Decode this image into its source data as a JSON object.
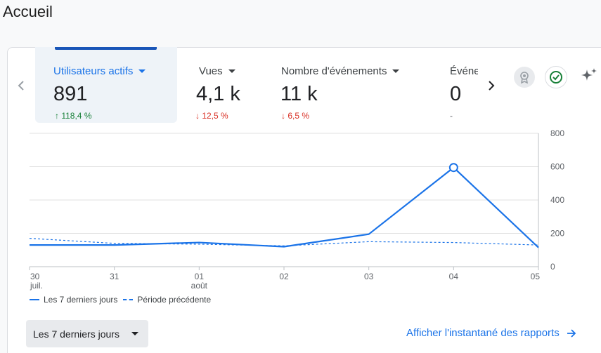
{
  "page": {
    "title": "Accueil"
  },
  "metrics": [
    {
      "label": "Utilisateurs actifs",
      "value": "891",
      "delta": "118,4 %",
      "trend": "up",
      "active": true
    },
    {
      "label": "Vues",
      "value": "4,1 k",
      "delta": "12,5 %",
      "trend": "down",
      "active": false
    },
    {
      "label": "Nombre d'événements",
      "value": "11 k",
      "delta": "6,5 %",
      "trend": "down",
      "active": false
    },
    {
      "label": "Événe",
      "value": "0",
      "delta": "-",
      "trend": "neutral",
      "active": false
    }
  ],
  "icons": {
    "prev": "chevron-left-icon",
    "next": "chevron-right-icon",
    "award": "award-icon",
    "check": "check-circle-icon",
    "sparkle": "sparkle-icon"
  },
  "colors": {
    "accent": "#1a73e8",
    "up": "#188038",
    "down": "#d93025"
  },
  "chart_data": {
    "type": "line",
    "categories": [
      "30 juil.",
      "31",
      "01 août",
      "02",
      "03",
      "04",
      "05"
    ],
    "x_tick_labels": [
      [
        "30",
        "juil."
      ],
      [
        "31"
      ],
      [
        "01",
        "août"
      ],
      [
        "02"
      ],
      [
        "03"
      ],
      [
        "04"
      ],
      [
        "05"
      ]
    ],
    "y_ticks": [
      "800",
      "600",
      "400",
      "200",
      "0"
    ],
    "ylim": [
      0,
      800
    ],
    "grid": true,
    "series": [
      {
        "name": "Les 7 derniers jours",
        "values": [
          130,
          130,
          145,
          120,
          195,
          595,
          115
        ],
        "style": "solid",
        "color": "#1a73e8"
      },
      {
        "name": "Période précédente",
        "values": [
          170,
          140,
          135,
          125,
          150,
          145,
          130
        ],
        "style": "dashed",
        "color": "#1a73e8"
      }
    ],
    "highlight_point_index": 5,
    "legend_position": "bottom-left"
  },
  "range": {
    "label": "Les 7 derniers jours"
  },
  "report_link": {
    "label": "Afficher l'instantané des rapports"
  }
}
